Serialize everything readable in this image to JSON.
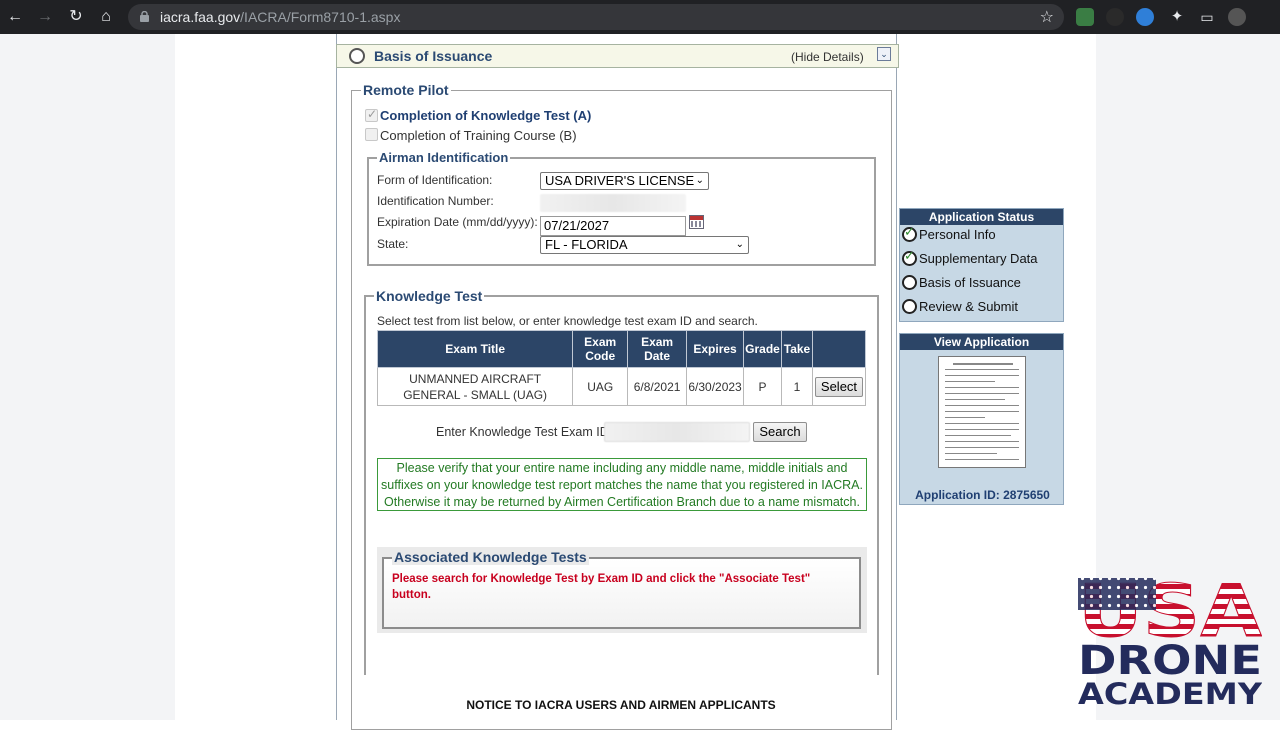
{
  "browser": {
    "url_host": "iacra.faa.gov",
    "url_path": "/IACRA/Form8710-1.aspx"
  },
  "section": {
    "title": "Basis of Issuance",
    "hide_details": "(Hide Details)"
  },
  "remote_pilot": {
    "legend": "Remote Pilot",
    "option_a": "Completion of Knowledge Test (A)",
    "option_b": "Completion of Training Course (B)"
  },
  "airman_id": {
    "legend": "Airman Identification",
    "form_label": "Form of Identification:",
    "form_value": "USA DRIVER'S LICENSE",
    "id_label": "Identification Number:",
    "exp_label": "Expiration Date (mm/dd/yyyy):",
    "exp_value": "07/21/2027",
    "state_label": "State:",
    "state_value": "FL - FLORIDA"
  },
  "knowledge_test": {
    "legend": "Knowledge Test",
    "instructions": "Select test from list below, or enter knowledge test exam ID and search.",
    "columns": [
      "Exam Title",
      "Exam Code",
      "Exam Date",
      "Expires",
      "Grade",
      "Take",
      ""
    ],
    "row": {
      "title": "UNMANNED AIRCRAFT GENERAL - SMALL (UAG)",
      "code": "UAG",
      "date": "6/8/2021",
      "expires": "6/30/2023",
      "grade": "P",
      "take": "1",
      "select_label": "Select"
    },
    "exam_id_label": "Enter Knowledge Test Exam ID:",
    "search_label": "Search",
    "verify_notice": "Please verify that your entire name including any middle name, middle initials and suffixes on your knowledge test report matches the name that you registered in IACRA. Otherwise it may be returned by Airmen Certification Branch due to a name mismatch."
  },
  "associated": {
    "legend": "Associated Knowledge Tests",
    "message": "Please search for Knowledge Test by Exam ID and click the \"Associate Test\" button."
  },
  "notice_title": "NOTICE TO IACRA USERS AND AIRMEN APPLICANTS",
  "status": {
    "header": "Application Status",
    "items": [
      {
        "label": "Personal Info",
        "done": true
      },
      {
        "label": "Supplementary Data",
        "done": true
      },
      {
        "label": "Basis of Issuance",
        "done": false
      },
      {
        "label": "Review & Submit",
        "done": false
      }
    ]
  },
  "view_app": {
    "header": "View Application",
    "app_id": "Application ID: 2875650"
  },
  "logo": {
    "line1": "USA",
    "line2": "DRONE",
    "line3": "ACADEMY"
  },
  "colors": {
    "header_navy": "#2c4567",
    "accent_blue": "#2b4a73",
    "warning_red": "#c8001e",
    "notice_green": "#237a23",
    "logo_navy": "#232b5c",
    "logo_red": "#c8102e"
  }
}
